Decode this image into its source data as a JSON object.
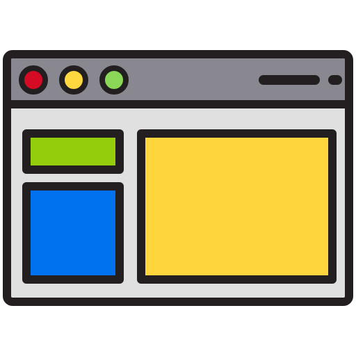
{
  "window": {
    "controls": [
      {
        "name": "close",
        "color": "#d50b26"
      },
      {
        "name": "minimize",
        "color": "#ffd73e"
      },
      {
        "name": "maximize",
        "color": "#8ad657"
      }
    ],
    "title_bar_color": "#898890",
    "content_background": "#e0e0e0",
    "outline_color": "#231f20"
  },
  "panels": [
    {
      "name": "sidebar-header-block",
      "color": "#94cd0b"
    },
    {
      "name": "sidebar-content-block",
      "color": "#0071ef"
    },
    {
      "name": "main-content-block",
      "color": "#ffd53e"
    }
  ]
}
